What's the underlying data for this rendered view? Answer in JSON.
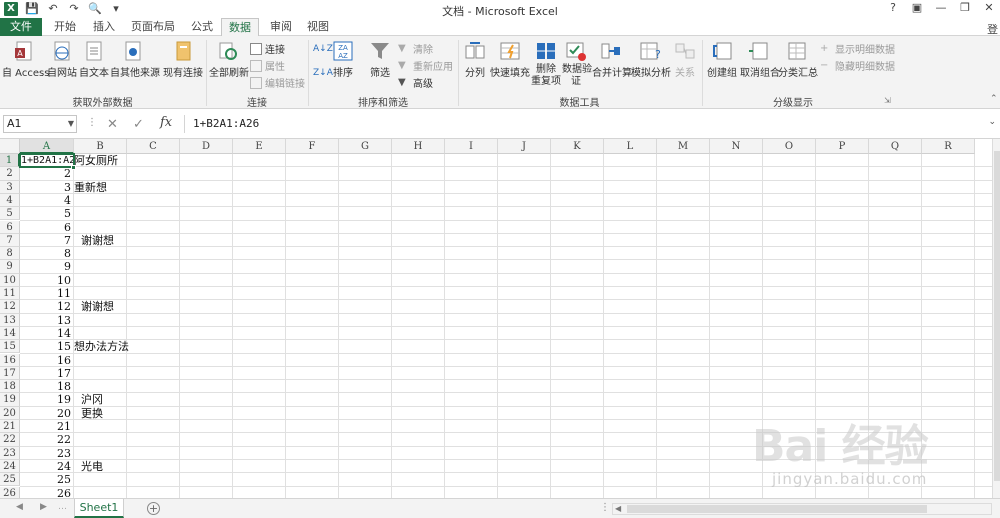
{
  "window": {
    "title": "文档 - Microsoft Excel",
    "login": "登"
  },
  "tabs": [
    "文件",
    "开始",
    "插入",
    "页面布局",
    "公式",
    "数据",
    "审阅",
    "视图"
  ],
  "active_tab": "数据",
  "ribbon": {
    "external": {
      "label": "获取外部数据",
      "access": "自 Access",
      "web": "自网站",
      "text": "自文本",
      "other": "自其他来源",
      "existing": "现有连接"
    },
    "connections": {
      "label": "连接",
      "refresh_all": "全部刷新",
      "connect": "连接",
      "properties": "属性",
      "edit_links": "编辑链接"
    },
    "sort_filter": {
      "label": "排序和筛选",
      "sort": "排序",
      "filter": "筛选",
      "clear": "清除",
      "reapply": "重新应用",
      "advanced": "高级"
    },
    "data_tools": {
      "label": "数据工具",
      "split": "分列",
      "flash_fill": "快速填充",
      "remove_dup_1": "删除",
      "remove_dup_2": "重复项",
      "validation_1": "数据验",
      "validation_2": "证",
      "consolidate": "合并计算",
      "whatif": "模拟分析",
      "relations": "关系"
    },
    "outline": {
      "label": "分级显示",
      "group": "创建组",
      "ungroup": "取消组合",
      "subtotal": "分类汇总",
      "show_detail": "显示明细数据",
      "hide_detail": "隐藏明细数据"
    }
  },
  "formula_bar": {
    "name_box": "A1",
    "formula": "1+B2A1:A26",
    "fx": "fx"
  },
  "columns": [
    "A",
    "B",
    "C",
    "D",
    "E",
    "F",
    "G",
    "H",
    "I",
    "J",
    "K",
    "L",
    "M",
    "N",
    "O",
    "P",
    "Q",
    "R"
  ],
  "rows": [
    "1",
    "2",
    "3",
    "4",
    "5",
    "6",
    "7",
    "8",
    "9",
    "10",
    "11",
    "12",
    "13",
    "14",
    "15",
    "16",
    "17",
    "18",
    "19",
    "20",
    "21",
    "22",
    "23",
    "24",
    "25",
    "26"
  ],
  "cells": {
    "A1": "1+B2A1:A26",
    "A": [
      "",
      "2",
      "3",
      "4",
      "5",
      "6",
      "7",
      "8",
      "9",
      "10",
      "11",
      "12",
      "13",
      "14",
      "15",
      "16",
      "17",
      "18",
      "19",
      "20",
      "21",
      "22",
      "23",
      "24",
      "25",
      "26"
    ],
    "B": {
      "1": "阿女厕所",
      "3": "重新想",
      "7": "  谢谢想",
      "12": "  谢谢想",
      "15": "想办法方法",
      "19": "  沪冈",
      "20": "  更换",
      "24": "  光电"
    }
  },
  "sheet_tab": "Sheet1",
  "watermark": {
    "logo": "Bai 经验",
    "url": "jingyan.baidu.com"
  }
}
